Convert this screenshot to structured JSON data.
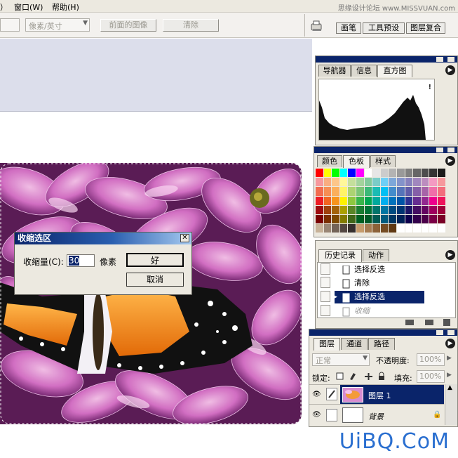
{
  "menu": {
    "items": [
      "窗口(W)",
      "帮助(H)"
    ],
    "left_fragment": "）"
  },
  "watermark_top": "思缘设计论坛 www.MISSVUAN.com",
  "options": {
    "units_select": "像素/英寸",
    "front_image_button": "前面的图像",
    "clear_button": "清除",
    "well_tabs": [
      "画笔",
      "工具预设",
      "图层复合"
    ]
  },
  "navigator_panel": {
    "tabs": [
      "导航器",
      "信息",
      "直方图"
    ],
    "active": "直方图",
    "warning": "!"
  },
  "swatches_panel": {
    "tabs": [
      "颜色",
      "色板",
      "样式"
    ],
    "active": "色板"
  },
  "history_panel": {
    "tabs": [
      "历史记录",
      "动作"
    ],
    "active": "历史记录",
    "items": [
      {
        "label": "选择反选",
        "state": "normal"
      },
      {
        "label": "清除",
        "state": "normal"
      },
      {
        "label": "选择反选",
        "state": "selected"
      },
      {
        "label": "收缩",
        "state": "dimmed"
      }
    ]
  },
  "layers_panel": {
    "tabs": [
      "图层",
      "通道",
      "路径"
    ],
    "active": "图层",
    "blend_mode": "正常",
    "opacity_label": "不透明度:",
    "opacity_value": "100%",
    "lock_label": "锁定:",
    "fill_label": "填充:",
    "fill_value": "100%",
    "layers": [
      {
        "name": "图层 1",
        "selected": true
      },
      {
        "name": "背景",
        "selected": false
      }
    ]
  },
  "dialog": {
    "title": "收缩选区",
    "field_label": "收缩量(C):",
    "field_value": "30",
    "unit": "像素",
    "ok_button": "好",
    "cancel_button": "取消"
  },
  "logo": "UiBQ.CoM",
  "colors": {
    "title_blue": "#0a246a",
    "selection_blue": "#0a246a",
    "panel_bg": "#ece9e0",
    "logo_blue": "#2a6fd0"
  }
}
